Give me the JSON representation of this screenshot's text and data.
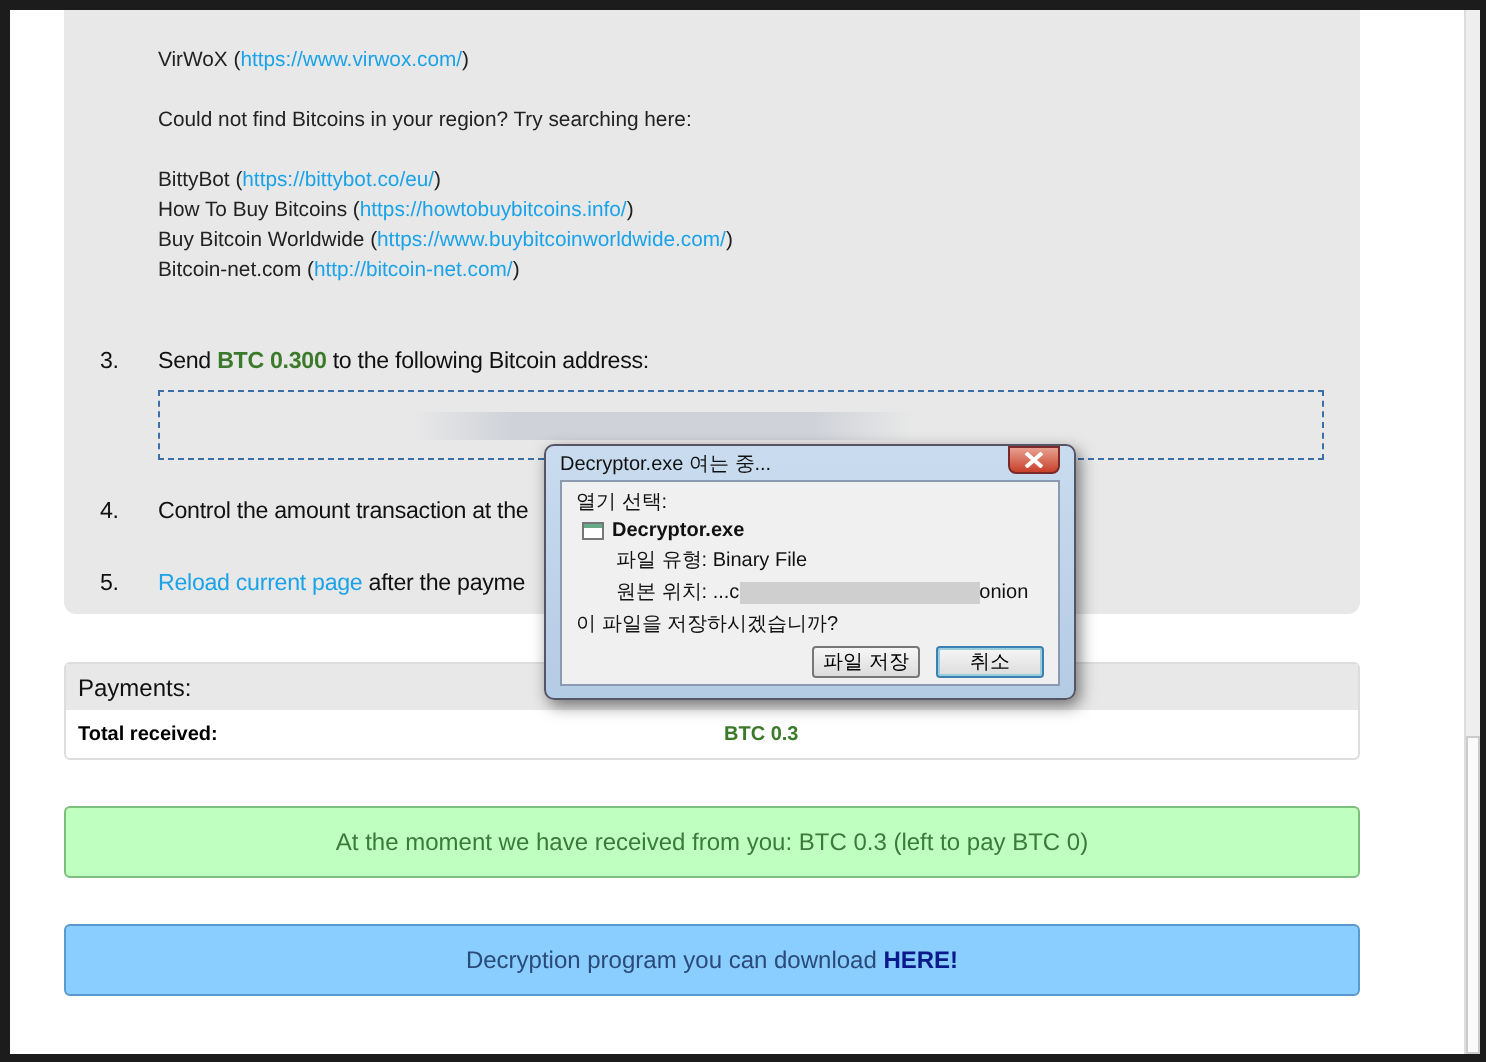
{
  "instructions": {
    "intro_links": [
      {
        "name": "VirWoX (",
        "url": "https://www.virwox.com/",
        "close": ")"
      }
    ],
    "region_prompt": "Could not find Bitcoins in your region? Try searching here:",
    "exchanges": [
      {
        "name": "BittyBot (",
        "url": "https://bittybot.co/eu/",
        "close": ")"
      },
      {
        "name": "How To Buy Bitcoins (",
        "url": "https://howtobuybitcoins.info/",
        "close": ")"
      },
      {
        "name": "Buy Bitcoin Worldwide (",
        "url": "https://www.buybitcoinworldwide.com/",
        "close": ")"
      },
      {
        "name": "Bitcoin-net.com (",
        "url": "http://bitcoin-net.com/",
        "close": ")"
      }
    ],
    "steps": [
      {
        "number": "3.",
        "kind": "address",
        "text": "Send **BTC 0.300** to the following Bitcoin address:"
      },
      {
        "number": "4.",
        "kind": "plain",
        "text": "Control the amount transaction at the"
      },
      {
        "number": "5.",
        "kind": "link",
        "link": "Reload current page",
        "text": " after the payme"
      }
    ]
  },
  "payments": {
    "title": "Payments:",
    "rows": [
      {
        "label": "Total received:",
        "value": "BTC 0.3"
      }
    ]
  },
  "status_notice": "At the moment we have received from you: BTC 0.3 (left to pay BTC 0)",
  "download": {
    "text": "Decryption program you can download ",
    "link": "HERE!"
  },
  "dialog": {
    "title": "Decryptor.exe 여는 중...",
    "prompt": "열기 선택:",
    "file_name": "Decryptor.exe",
    "file_type": "파일 유형: Binary File",
    "source": "원본 위치: ...c",
    "source_tail": "onion",
    "question": "이 파일을 저장하시겠습니까?",
    "buttons": [
      {
        "label": "파일 저장",
        "focused": false
      },
      {
        "label": "취소",
        "focused": true
      }
    ]
  }
}
